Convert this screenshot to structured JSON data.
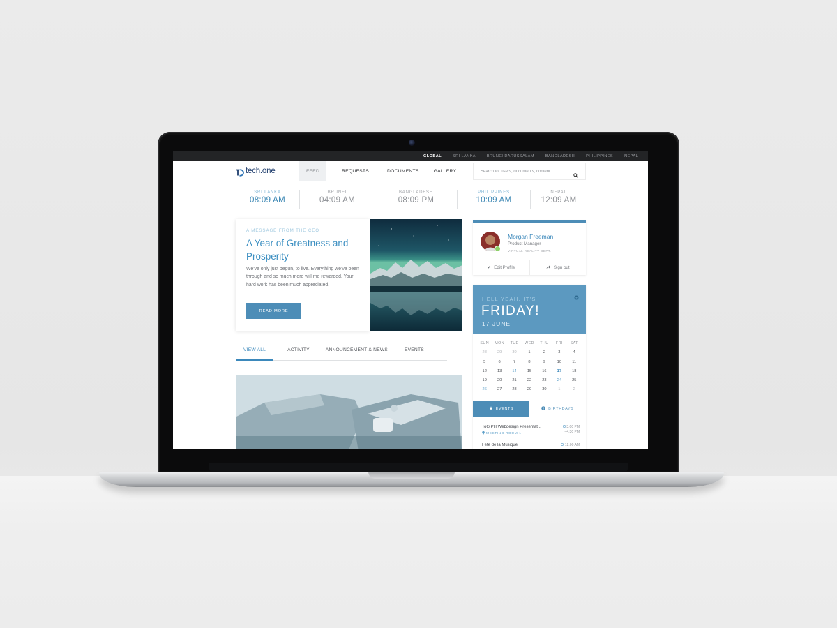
{
  "topbar": {
    "regions": [
      "GLOBAL",
      "SRI LANKA",
      "BRUNEI DARUSSALAM",
      "BANGLADESH",
      "PHILIPPINES",
      "NEPAL"
    ]
  },
  "nav": {
    "logo_text": "tech.one",
    "links": {
      "feed": "FEED",
      "requests": "REQUESTS",
      "documents": "DOCUMENTS",
      "gallery": "GALLERY"
    },
    "search_placeholder": "Search for users, documents, content"
  },
  "clocks": [
    {
      "name": "SRI LANKA",
      "time": "08:09 AM"
    },
    {
      "name": "BRUNEI",
      "time": "04:09 AM"
    },
    {
      "name": "BANGLADESH",
      "time": "08:09 PM"
    },
    {
      "name": "PHILIPPINES",
      "time": "10:09 AM"
    },
    {
      "name": "NEPAL",
      "time": "12:09 AM"
    }
  ],
  "message": {
    "eyebrow": "A MESSAGE FROM THE CEO",
    "title": "A Year of Greatness and Prosperity",
    "body": "We've only just begun, to live. Everything we've been through and so much more will me rewarded. Your hard work has been much appreciated.",
    "button": "READ MORE"
  },
  "tabs": [
    "VIEW ALL",
    "ACTIVITY",
    "ANNOUNCEMENT & NEWS",
    "EVENTS"
  ],
  "profile": {
    "name": "Morgan Freeman",
    "role": "Product Manager",
    "dept": "VIRTUAL REALITY DEPT.",
    "edit_label": "Edit Profile",
    "signout_label": "Sign out"
  },
  "calendar": {
    "eyebrow": "HELL YEAH, IT'S",
    "day_word": "FRIDAY!",
    "date": "17 JUNE",
    "days_of_week": [
      "SUN",
      "MON",
      "TUE",
      "WED",
      "THU",
      "FRI",
      "SAT"
    ],
    "weeks": [
      [
        "28",
        "29",
        "30",
        "1",
        "2",
        "3",
        "4"
      ],
      [
        "5",
        "6",
        "7",
        "8",
        "9",
        "10",
        "11"
      ],
      [
        "12",
        "13",
        "14",
        "15",
        "16",
        "17",
        "18"
      ],
      [
        "19",
        "20",
        "21",
        "22",
        "23",
        "24",
        "25"
      ],
      [
        "26",
        "27",
        "28",
        "29",
        "30",
        "1",
        "2"
      ]
    ],
    "tabs": {
      "events": "EVENTS",
      "birthdays": "BIRTHDAYS"
    },
    "events": [
      {
        "title": "ToG PH Webdesign Presentat...",
        "location": "MEETING ROOM 1",
        "time_start": "3:00 PM",
        "time_end": "- 4:30 PM"
      },
      {
        "title": "Fete de la Musique",
        "location": "",
        "time_start": "12:00 AM",
        "time_end": ""
      }
    ]
  },
  "colors": {
    "accent": "#3b88bb",
    "button": "#4d8db7",
    "calendar_header": "#5c99c0",
    "online": "#8ed06a",
    "topbar": "#232426"
  }
}
